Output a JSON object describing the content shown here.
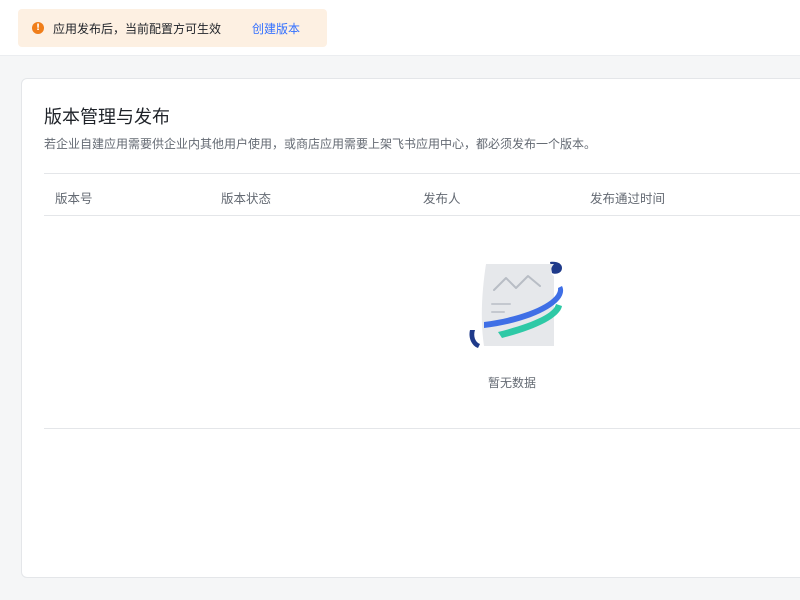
{
  "notice": {
    "icon": "exclamation-icon",
    "text": "应用发布后，当前配置方可生效",
    "link": "创建版本",
    "colors": {
      "background": "#fdf0e2",
      "icon": "#f07e1a",
      "link": "#3370ff"
    }
  },
  "section": {
    "title": "版本管理与发布",
    "description": "若企业自建应用需要供企业内其他用户使用，或商店应用需要上架飞书应用中心，都必须发布一个版本。"
  },
  "table": {
    "columns": [
      "版本号",
      "版本状态",
      "发布人",
      "发布通过时间"
    ],
    "rows": [],
    "empty": {
      "icon": "empty-document-icon",
      "text": "暂无数据"
    }
  }
}
